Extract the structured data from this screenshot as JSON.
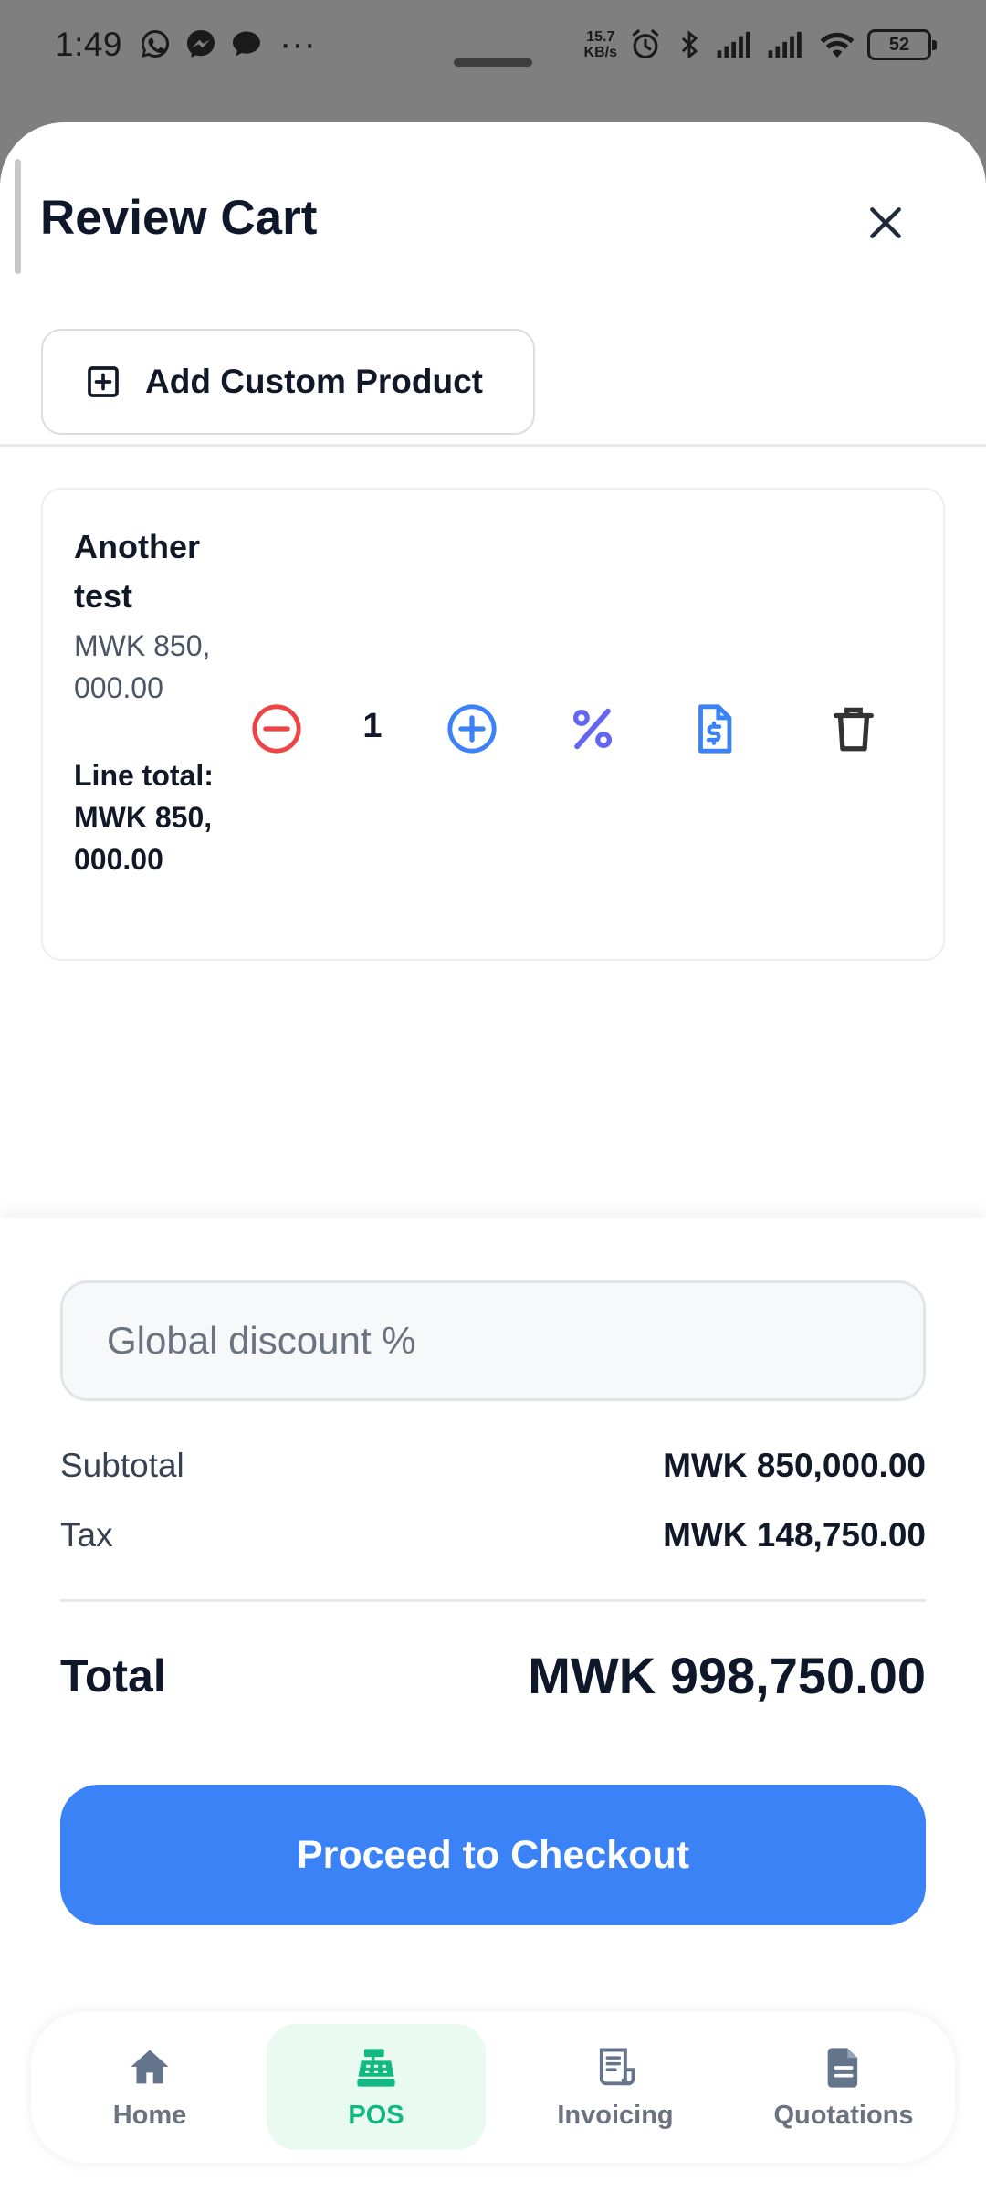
{
  "status_bar": {
    "time": "1:49",
    "speed_top": "15.7",
    "speed_bottom": "KB/s",
    "battery": "52"
  },
  "sheet": {
    "title": "Review Cart",
    "add_custom_label": "Add Custom Product"
  },
  "cart_items": [
    {
      "name": "Another test",
      "price": "MWK 850,000.00",
      "line_total_label": "Line total:",
      "line_total": "MWK 850,000.00",
      "quantity": "1"
    }
  ],
  "summary": {
    "discount_placeholder": "Global discount %",
    "subtotal_label": "Subtotal",
    "subtotal_value": "MWK 850,000.00",
    "tax_label": "Tax",
    "tax_value": "MWK 148,750.00",
    "total_label": "Total",
    "total_value": "MWK 998,750.00",
    "checkout_label": "Proceed to Checkout"
  },
  "bottom_nav": {
    "items": [
      {
        "label": "Home",
        "icon": "home-icon"
      },
      {
        "label": "POS",
        "icon": "cash-register-icon"
      },
      {
        "label": "Invoicing",
        "icon": "receipt-icon"
      },
      {
        "label": "Quotations",
        "icon": "document-icon"
      }
    ],
    "active": "POS"
  },
  "colors": {
    "primary": "#3b82f6",
    "danger": "#ef4444",
    "discount": "#6366f1",
    "active_nav": "#10b981",
    "active_nav_bg": "#e9faf1"
  }
}
